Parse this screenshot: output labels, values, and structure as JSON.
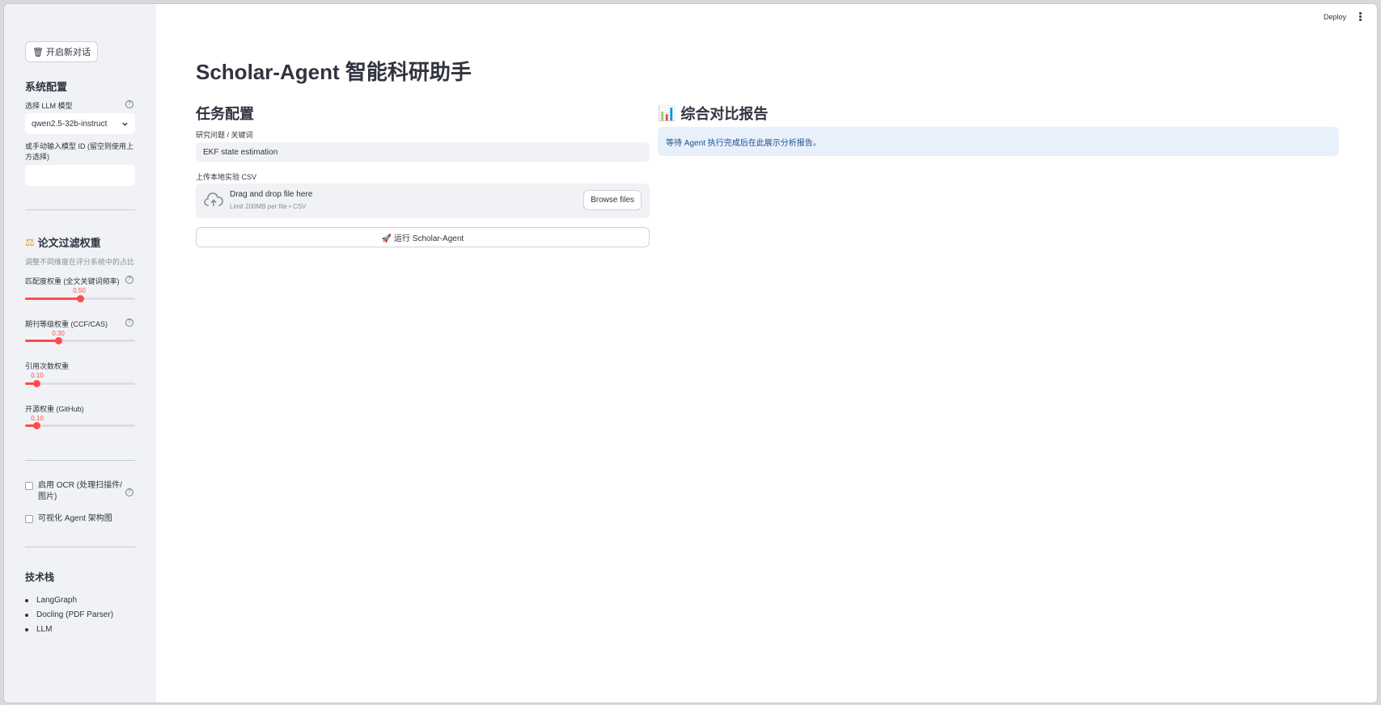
{
  "header": {
    "deploy_label": "Deploy",
    "menu_icon": "more-vertical-icon"
  },
  "sidebar": {
    "new_chat_label": "🗑 开启新对话",
    "system_config_heading": "系统配置",
    "llm_select_label": "选择 LLM 模型",
    "llm_selected": "qwen2.5-32b-instruct",
    "manual_model_label_line1": "或手动输入模型 ID (留空则使用上",
    "manual_model_label_line2": "方选择)",
    "manual_model_value": "",
    "weights_heading": "论文过滤权重",
    "weights_icon": "⚖",
    "weights_desc": "调整不同维度在评分系统中的占比",
    "sliders": [
      {
        "label": "匹配度权重 (全文关键词频率)",
        "value": "0.50",
        "fraction": 0.5,
        "help": true
      },
      {
        "label": "期刊等级权重 (CCF/CAS)",
        "value": "0.30",
        "fraction": 0.3,
        "help": true
      },
      {
        "label": "引用次数权重",
        "value": "0.10",
        "fraction": 0.1,
        "help": false
      },
      {
        "label": "开源权重 (GitHub)",
        "value": "0.10",
        "fraction": 0.1,
        "help": false
      }
    ],
    "ocr_label_line1": "启用 OCR (处理扫描件/",
    "ocr_label_line2": "图片)",
    "ocr_checked": false,
    "viz_label": "可视化 Agent 架构图",
    "viz_checked": false,
    "tech_heading": "技术栈",
    "tech_items": [
      "LangGraph",
      "Docling (PDF Parser)",
      "LLM"
    ]
  },
  "main": {
    "title": "Scholar-Agent 智能科研助手",
    "task_heading": "任务配置",
    "query_label": "研究问题 / 关键词",
    "query_value": "EKF state estimation",
    "upload_label": "上传本地实验 CSV",
    "dropzone_main": "Drag and drop file here",
    "dropzone_sub": "Limit 200MB per file • CSV",
    "browse_label": "Browse files",
    "run_label": "🚀 运行 Scholar-Agent",
    "report_heading": "综合对比报告",
    "report_icon": "📊",
    "report_info": "等待 Agent 执行完成后在此展示分析报告。"
  }
}
